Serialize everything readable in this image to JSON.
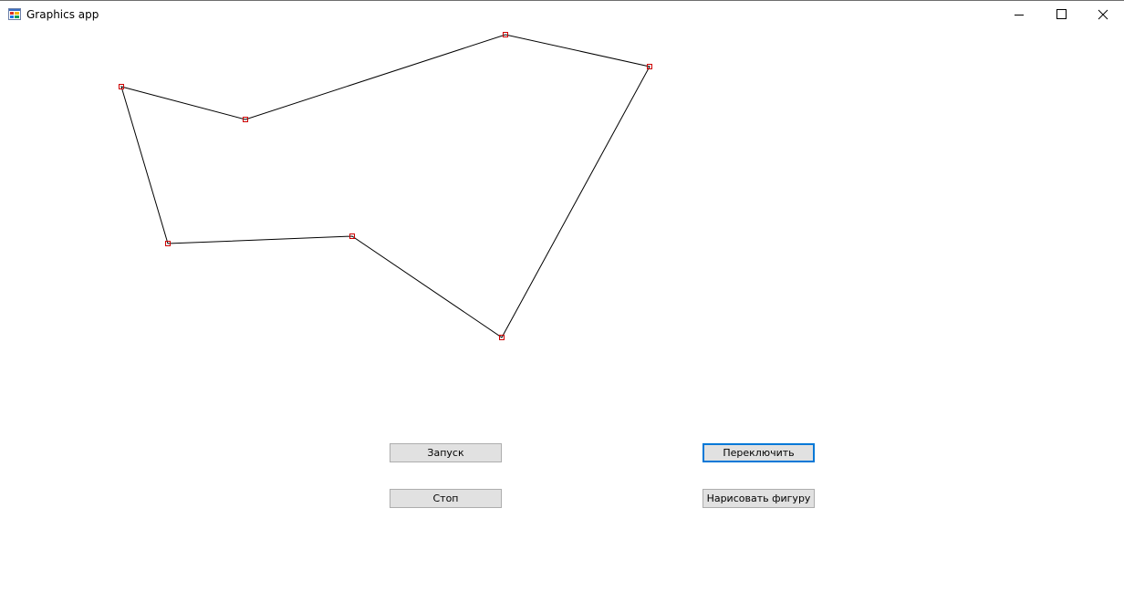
{
  "window": {
    "title": "Graphics app",
    "icon": "windows-forms-app-icon",
    "controls": {
      "minimize_icon": "minimize-icon",
      "maximize_icon": "maximize-icon",
      "close_icon": "close-icon"
    }
  },
  "buttons": {
    "start_label": "Запуск",
    "stop_label": "Стоп",
    "switch_label": "Переключить",
    "draw_label": "Нарисовать фигуру",
    "focused": "switch"
  },
  "colors": {
    "polygon_stroke": "#000000",
    "vertex_marker": "#cc0000",
    "focus_border": "#0078d7"
  }
}
